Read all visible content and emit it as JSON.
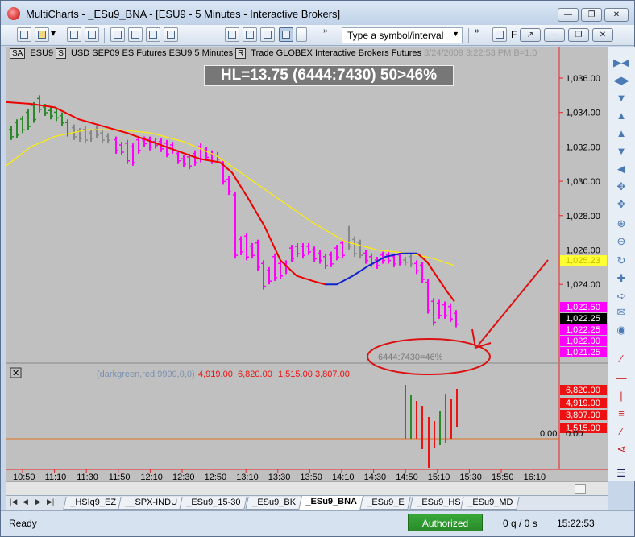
{
  "window": {
    "title": "MultiCharts - _ESu9_BNA - [ESU9 - 5 Minutes - Interactive Brokers]",
    "controls": [
      "minimize",
      "restore",
      "close"
    ]
  },
  "toolbar": {
    "symbol_placeholder": "Type a symbol/interval",
    "f_label": "F"
  },
  "chart": {
    "infobar": {
      "tag_sa": "SA",
      "symbol": "ESU9",
      "tag_s": "S",
      "description": "USD SEP09 ES Futures ESU9  5 Minutes",
      "tag_r": "R",
      "feed": "Trade  GLOBEX  Interactive Brokers  Futures",
      "date_time": "8/24/2009   3:22:53 PM   B=1.0"
    },
    "hl_banner": "HL=13.75 (6444:7430) 50>46%",
    "ellipse_label": "6444:7430=46%",
    "indicator_params": "(darkgreen,red,9999,0,0)",
    "indicator_values": [
      "4,919.00",
      "6,820.00",
      "1,515.00",
      "3,807.00"
    ],
    "zero_label": "0.00",
    "price_axis_labels": [
      "1,036.00",
      "1,034.00",
      "1,032.00",
      "1,030.00",
      "1,028.00",
      "1,026.00",
      "1,024.00"
    ],
    "price_markers": [
      {
        "text": "1,025.23",
        "bg": "#ffff33",
        "fg": "#c0c000"
      },
      {
        "text": "1,022.50",
        "bg": "#ff00ff",
        "fg": "#ffffff"
      },
      {
        "text": "1,022.25",
        "bg": "#000000",
        "fg": "#ffffff"
      },
      {
        "text": "1,022.25",
        "bg": "#ff00ff",
        "fg": "#ffffff"
      },
      {
        "text": "1,022.00",
        "bg": "#ff00ff",
        "fg": "#ffffff"
      },
      {
        "text": "1,021.25",
        "bg": "#ff00ff",
        "fg": "#ffffff"
      }
    ],
    "indicator_markers": [
      {
        "text": "6,820.00",
        "bg": "#ee1111",
        "fg": "#ffffff"
      },
      {
        "text": "4,919.00",
        "bg": "#ee1111",
        "fg": "#ffffff"
      },
      {
        "text": "3,807.00",
        "bg": "#ee1111",
        "fg": "#ffffff"
      },
      {
        "text": "1,515.00",
        "bg": "#ee1111",
        "fg": "#ffffff"
      },
      {
        "text": "0.00",
        "bg": "#c0c0c0",
        "fg": "#000000"
      }
    ],
    "time_labels": [
      "10:50",
      "11:10",
      "11:30",
      "11:50",
      "12:10",
      "12:30",
      "12:50",
      "13:10",
      "13:30",
      "13:50",
      "14:10",
      "14:30",
      "14:50",
      "15:10",
      "15:30",
      "15:50",
      "16:10"
    ],
    "colors": {
      "up_bars": "#ff00ff",
      "down_bars": "#ff00ff",
      "ma_fast": "#ee0000",
      "ma_slow": "#ffee00",
      "ma_blue": "#1122cc",
      "annotation": "#dd1111"
    }
  },
  "tabs": {
    "items": [
      "_HSIq9_EZ",
      "__SPX-INDU",
      "_ESu9_15-30",
      "_ESu9_BK",
      "_ESu9_BNA",
      "_ESu9_E",
      "_ESu9_HS",
      "_ESu9_MD"
    ],
    "active": "_ESu9_BNA"
  },
  "status": {
    "ready": "Ready",
    "authorized": "Authorized",
    "queue": "0 q / 0 s",
    "time": "15:22:53"
  }
}
